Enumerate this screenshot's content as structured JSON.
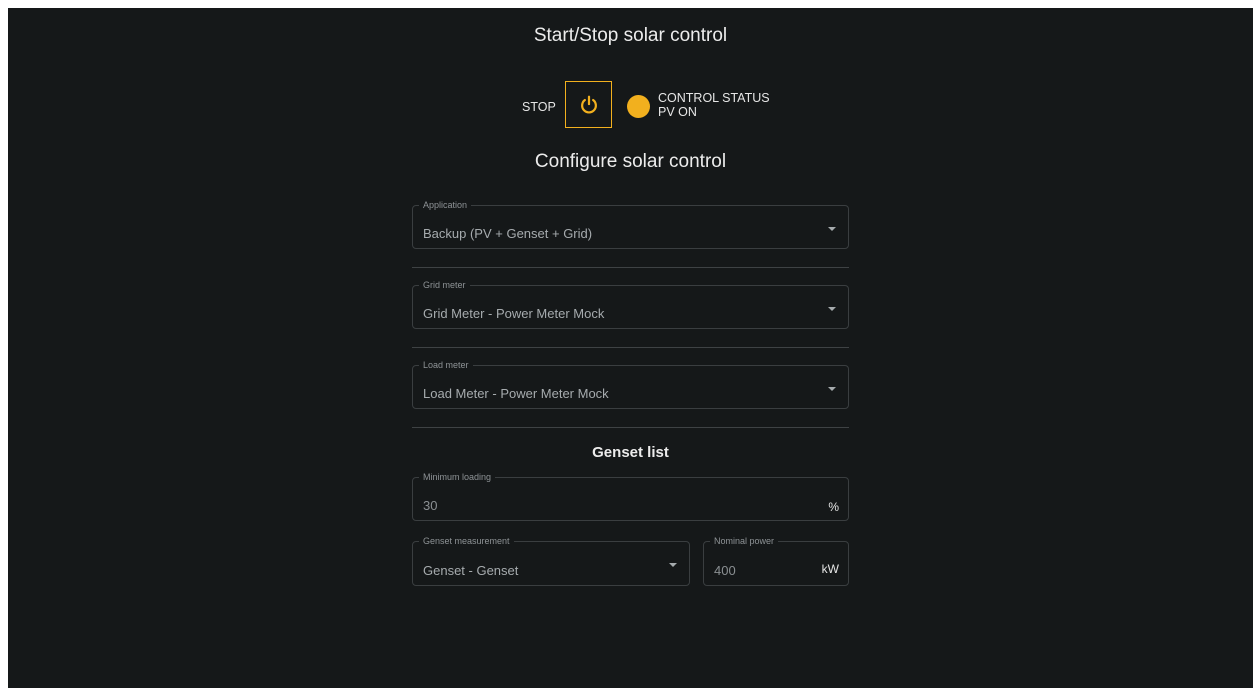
{
  "start_stop": {
    "title": "Start/Stop solar control",
    "stop_label": "STOP",
    "power_icon": "power-icon",
    "status_label": "CONTROL STATUS",
    "status_value": "PV ON",
    "accent_color": "#f2b01e"
  },
  "configure": {
    "title": "Configure solar control",
    "application": {
      "label": "Application",
      "value": "Backup (PV + Genset + Grid)"
    },
    "grid_meter": {
      "label": "Grid meter",
      "value": "Grid Meter - Power Meter Mock"
    },
    "load_meter": {
      "label": "Load meter",
      "value": "Load Meter - Power Meter Mock"
    }
  },
  "genset": {
    "title": "Genset list",
    "minimum_loading": {
      "label": "Minimum loading",
      "value": "30",
      "unit": "%"
    },
    "measurement": {
      "label": "Genset measurement",
      "value": "Genset - Genset"
    },
    "nominal_power": {
      "label": "Nominal power",
      "value": "400",
      "unit": "kW"
    }
  }
}
